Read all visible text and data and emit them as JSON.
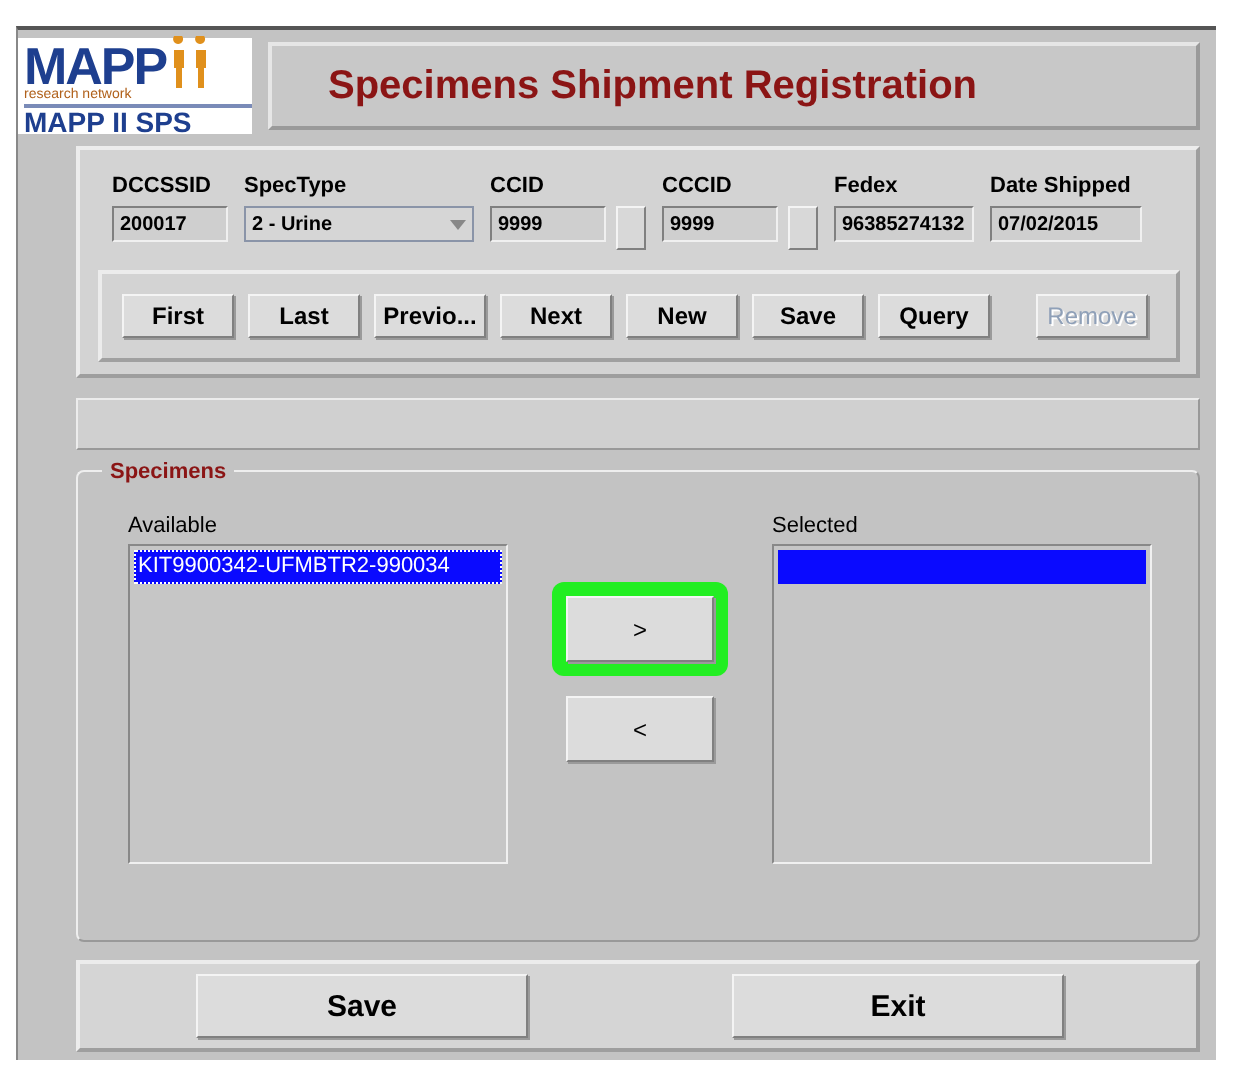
{
  "logo": {
    "brand": "MAPP",
    "tagline": "research network",
    "product": "MAPP II SPS"
  },
  "window": {
    "title": "Specimens Shipment Registration"
  },
  "fields": [
    {
      "kind": "text",
      "label": "DCCSSID",
      "value": "200017"
    },
    {
      "kind": "dropdown",
      "label": "SpecType",
      "value": "2 - Urine"
    },
    {
      "kind": "text",
      "label": "CCID",
      "value": "9999",
      "has_button": true
    },
    {
      "kind": "text",
      "label": "CCCID",
      "value": "9999",
      "has_button": true
    },
    {
      "kind": "text",
      "label": "Fedex",
      "value": "96385274132"
    },
    {
      "kind": "text",
      "label": "Date Shipped",
      "value": "07/02/2015"
    }
  ],
  "nav_buttons": [
    {
      "label": "First",
      "disabled": false
    },
    {
      "label": "Last",
      "disabled": false
    },
    {
      "label": "Previo...",
      "disabled": false
    },
    {
      "label": "Next",
      "disabled": false
    },
    {
      "label": "New",
      "disabled": false
    },
    {
      "label": "Save",
      "disabled": false
    },
    {
      "label": "Query",
      "disabled": false
    },
    {
      "label": "Remove",
      "disabled": true
    }
  ],
  "specimens": {
    "title": "Specimens",
    "available": {
      "label": "Available",
      "items": [
        {
          "text": "KIT9900342-UFMBTR2-990034",
          "selected": true
        }
      ]
    },
    "selected": {
      "label": "Selected",
      "empty_row_selected": true
    },
    "move_buttons": [
      {
        "label": ">",
        "highlighted": true
      },
      {
        "label": "<",
        "highlighted": false
      }
    ]
  },
  "footer_buttons": [
    "Save",
    "Exit"
  ]
}
